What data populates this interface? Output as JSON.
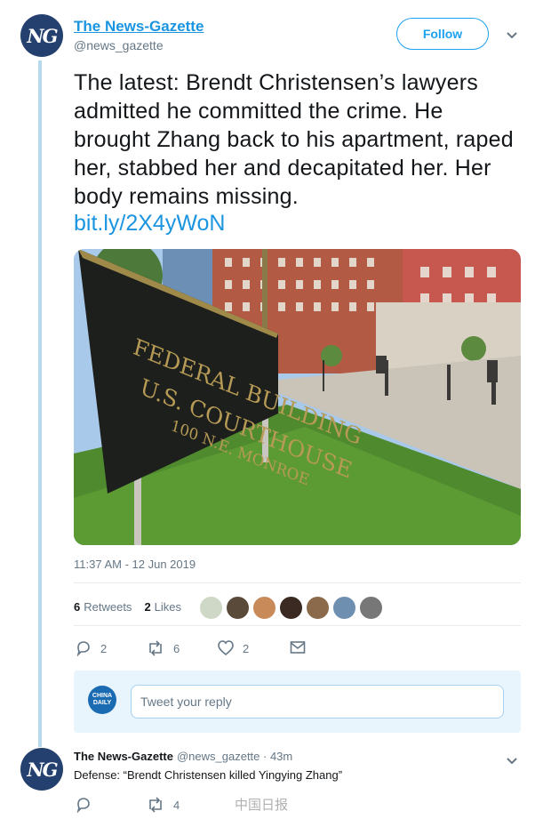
{
  "account": {
    "avatar_initials": "NG",
    "name": "The News-Gazette",
    "handle": "@news_gazette",
    "follow_label": "Follow",
    "avatar_color": "#24406e"
  },
  "tweet": {
    "text": "The latest: Brendt Christensen’s lawyers admitted he committed the crime. He brought Zhang back to his apartment, raped her, stabbed her and decapitated her. Her body remains missing.",
    "link": "bit.ly/2X4yWoN",
    "photo": {
      "sign_line1": "FEDERAL BUILDING",
      "sign_line2": "U.S. COURTHOUSE",
      "sign_line3": "100 N.E. MONROE"
    },
    "timestamp": "11:37 AM - 12 Jun 2019",
    "retweets_count": "6",
    "retweets_label": "Retweets",
    "likes_count": "2",
    "likes_label": "Likes",
    "actions": {
      "replies": "2",
      "retweets": "6",
      "likes": "2"
    }
  },
  "reply_composer": {
    "avatar_text": "CHINA DAILY",
    "placeholder": "Tweet your reply"
  },
  "reply": {
    "avatar_initials": "NG",
    "name": "The News-Gazette",
    "handle_time": "@news_gazette · 43m",
    "text": "Defense: “Brendt Christensen killed Yingying Zhang”",
    "actions": {
      "retweets": "4"
    }
  },
  "watermark": "中国日报",
  "colors": {
    "accent": "#1da1f2",
    "link": "#1b95e0",
    "thread_line": "#b7d9ee"
  }
}
